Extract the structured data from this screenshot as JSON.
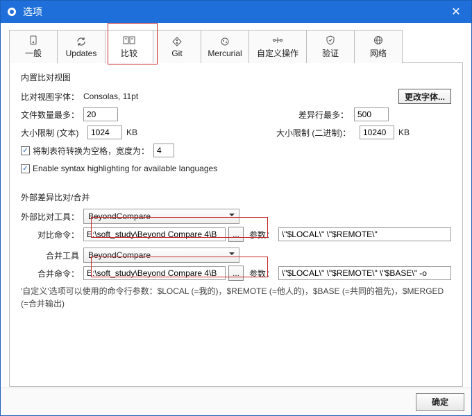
{
  "window": {
    "title": "选项"
  },
  "tabs": [
    {
      "label": "一般"
    },
    {
      "label": "Updates"
    },
    {
      "label": "比较"
    },
    {
      "label": "Git"
    },
    {
      "label": "Mercurial"
    },
    {
      "label": "自定义操作"
    },
    {
      "label": "验证"
    },
    {
      "label": "网络"
    }
  ],
  "builtin": {
    "section_title": "内置比对视图",
    "font_label": "比对视图字体：",
    "font_value": "Consolas, 11pt",
    "change_font": "更改字体...",
    "max_files_label": "文件数量最多：",
    "max_files_value": "20",
    "max_diff_lines_label": "差异行最多：",
    "max_diff_lines_value": "500",
    "size_text_label": "大小限制 (文本)",
    "size_text_value": "1024",
    "size_text_unit": "KB",
    "size_bin_label": "大小限制 (二进制)：",
    "size_bin_value": "10240",
    "size_bin_unit": "KB",
    "tabs_to_spaces_label": "将制表符转换为空格，宽度为：",
    "tabs_to_spaces_value": "4",
    "syntax_label": "Enable syntax highlighting for available languages"
  },
  "external": {
    "section_title": "外部差异比对/合并",
    "diff_tool_label": "外部比对工具：",
    "diff_tool_value": "BeyondCompare",
    "diff_cmd_label": "对比命令：",
    "diff_cmd_value": "E:\\soft_study\\Beyond Compare 4\\B",
    "diff_args_label": "参数：",
    "diff_args_value": "\\\"$LOCAL\\\" \\\"$REMOTE\\\"",
    "merge_tool_label": "合并工具",
    "merge_tool_value": "BeyondCompare",
    "merge_cmd_label": "合并命令：",
    "merge_cmd_value": "E:\\soft_study\\Beyond Compare 4\\B",
    "merge_args_label": "参数：",
    "merge_args_value": "\\\"$LOCAL\\\" \\\"$REMOTE\\\" \\\"$BASE\\\" -o",
    "hint": "'自定义'选项可以使用的命令行参数：$LOCAL (=我的)，$REMOTE (=他人的)，$BASE (=共同的祖先)，$MERGED (=合并输出)"
  },
  "footer": {
    "ok": "确定"
  }
}
